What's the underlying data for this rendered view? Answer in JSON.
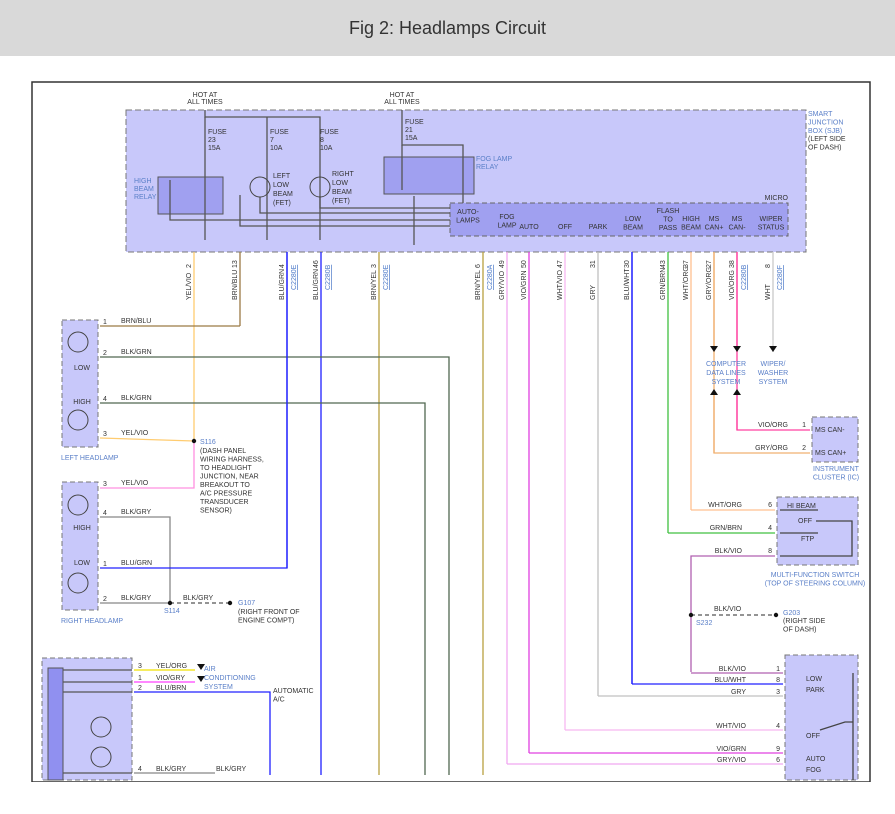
{
  "title": "Fig 2: Headlamps Circuit",
  "sjb": {
    "hot1": [
      "HOT AT",
      "ALL TIMES"
    ],
    "hot2": [
      "HOT AT",
      "ALL TIMES"
    ],
    "fuse23": [
      "FUSE",
      "23",
      "15A"
    ],
    "fuse7": [
      "FUSE",
      "7",
      "10A"
    ],
    "fuse8": [
      "FUSE",
      "8",
      "10A"
    ],
    "fuse21": [
      "FUSE",
      "21",
      "15A"
    ],
    "high_beam_relay": [
      "HIGH",
      "BEAM",
      "RELAY"
    ],
    "left_low_beam": [
      "LEFT",
      "LOW",
      "BEAM",
      "(FET)"
    ],
    "right_low_beam": [
      "RIGHT",
      "LOW",
      "BEAM",
      "(FET)"
    ],
    "fog_lamp_relay": [
      "FOG LAMP",
      "RELAY"
    ],
    "name": [
      "SMART",
      "JUNCTION",
      "BOX (SJB)"
    ],
    "location": [
      "(LEFT SIDE",
      "OF DASH)"
    ],
    "micro": "MICRO",
    "micro_pins": [
      [
        "AUTO-",
        "LAMPS"
      ],
      [
        "FOG",
        "LAMP"
      ],
      [
        "AUTO"
      ],
      [
        "OFF"
      ],
      [
        "PARK"
      ],
      [
        "LOW",
        "BEAM"
      ],
      [
        "FLASH",
        "TO",
        "PASS"
      ],
      [
        "HIGH",
        "BEAM"
      ],
      [
        "MS",
        "CAN+"
      ],
      [
        "MS",
        "CAN-"
      ],
      [
        "WIPER",
        "STATUS"
      ]
    ]
  },
  "wires": [
    {
      "label": "YEL/VIO",
      "pin": "2",
      "conn": "",
      "color": "#ffcc70"
    },
    {
      "label": "BRN/BLU",
      "pin": "13",
      "conn": "",
      "color": "#9b7a45"
    },
    {
      "label": "BLU/GRN",
      "pin": "4",
      "conn": "C2280E",
      "color": "#2020ff"
    },
    {
      "label": "BLU/GRN",
      "pin": "46",
      "conn": "C2280B",
      "color": "#2020ff"
    },
    {
      "label": "BRN/YEL",
      "pin": "3",
      "conn": "C2280E",
      "color": "#b8a040"
    },
    {
      "label": "BRN/YEL",
      "pin": "6",
      "conn": "C2280A",
      "color": "#b8a040"
    },
    {
      "label": "GRY/VIO",
      "pin": "49",
      "conn": "",
      "color": "#f0a8f0"
    },
    {
      "label": "VIO/GRN",
      "pin": "50",
      "conn": "",
      "color": "#e040e0"
    },
    {
      "label": "WHT/VIO",
      "pin": "47",
      "conn": "",
      "color": "#f8b8f0"
    },
    {
      "label": "GRY",
      "pin": "31",
      "conn": "",
      "color": "#c0c0c0"
    },
    {
      "label": "BLU/WHT",
      "pin": "30",
      "conn": "",
      "color": "#2020ff"
    },
    {
      "label": "GRN/BRN",
      "pin": "43",
      "conn": "",
      "color": "#40c040"
    },
    {
      "label": "WHT/ORG",
      "pin": "37",
      "conn": "",
      "color": "#ffc090"
    },
    {
      "label": "GRY/ORG",
      "pin": "27",
      "conn": "",
      "color": "#f0b070"
    },
    {
      "label": "VIO/ORG",
      "pin": "38",
      "conn": "C2280B",
      "color": "#ff40a0"
    },
    {
      "label": "WHT",
      "pin": "8",
      "conn": "C2280F",
      "color": "#d0d0d0"
    }
  ],
  "left_headlamp": {
    "name": "LEFT HEADLAMP",
    "low": "LOW",
    "high": "HIGH",
    "pins": [
      {
        "pin": "1",
        "wire": "BRN/BLU"
      },
      {
        "pin": "2",
        "wire": "BLK/GRN"
      },
      {
        "pin": "4",
        "wire": "BLK/GRN"
      },
      {
        "pin": "3",
        "wire": "YEL/VIO"
      }
    ]
  },
  "right_headlamp": {
    "name": "RIGHT HEADLAMP",
    "low": "LOW",
    "high": "HIGH",
    "pins": [
      {
        "pin": "3",
        "wire": "YEL/VIO"
      },
      {
        "pin": "4",
        "wire": "BLK/GRY"
      },
      {
        "pin": "1",
        "wire": "BLU/GRN"
      },
      {
        "pin": "2",
        "wire": "BLK/GRY"
      }
    ]
  },
  "s116": {
    "id": "S116",
    "desc": [
      "(DASH PANEL",
      "WIRING HARNESS,",
      "TO HEADLIGHT",
      "JUNCTION, NEAR",
      "BREAKOUT TO",
      "A/C PRESSURE",
      "TRANSDUCER",
      "SENSOR)"
    ]
  },
  "s114": "S114",
  "g107": {
    "id": "G107",
    "wire": "BLK/GRY",
    "desc": [
      "(RIGHT FRONT OF",
      "ENGINE COMPT)"
    ]
  },
  "computer_data": [
    "COMPUTER",
    "DATA LINES",
    "SYSTEM"
  ],
  "wiper": [
    "WIPER/",
    "WASHER",
    "SYSTEM"
  ],
  "ic": {
    "name": [
      "INSTRUMENT",
      "CLUSTER (IC)"
    ],
    "pins": [
      {
        "pin": "1",
        "wire": "VIO/ORG",
        "label": "MS CAN-"
      },
      {
        "pin": "2",
        "wire": "GRY/ORG",
        "label": "MS CAN+"
      }
    ]
  },
  "mfs": {
    "name": [
      "MULTI-FUNCTION SWITCH",
      "(TOP OF STEERING COLUMN)"
    ],
    "pins": [
      {
        "pin": "6",
        "wire": "WHT/ORG",
        "label": "HI BEAM"
      },
      {
        "pin": "4",
        "wire": "GRN/BRN",
        "label": "FTP"
      },
      {
        "pin": "8",
        "wire": "BLK/VIO",
        "label": ""
      }
    ],
    "off": "OFF"
  },
  "s232": "S232",
  "g203": {
    "id": "G203",
    "wire": "BLK/VIO",
    "desc": [
      "(RIGHT SIDE",
      "OF DASH)"
    ]
  },
  "headlamp_switch": {
    "pins": [
      {
        "pin": "1",
        "wire": "BLK/VIO",
        "label": "LOW"
      },
      {
        "pin": "8",
        "wire": "BLU/WHT",
        "label": "PARK"
      },
      {
        "pin": "3",
        "wire": "GRY",
        "label": ""
      },
      {
        "pin": "4",
        "wire": "WHT/VIO",
        "label": "OFF"
      },
      {
        "pin": "9",
        "wire": "VIO/GRN",
        "label": "AUTO"
      },
      {
        "pin": "6",
        "wire": "GRY/VIO",
        "label": "FOG"
      }
    ]
  },
  "ac_module": {
    "pins": [
      {
        "pin": "3",
        "wire": "YEL/ORG",
        "color": "#f0e000"
      },
      {
        "pin": "1",
        "wire": "VIO/GRY",
        "color": "#ff40ff"
      },
      {
        "pin": "2",
        "wire": "BLU/BRN",
        "color": "#2020ff"
      },
      {
        "pin": "4",
        "wire": "BLK/GRY",
        "color": "#909090"
      }
    ],
    "ac_system": [
      "AIR",
      "CONDITIONING",
      "SYSTEM"
    ],
    "auto_ac": [
      "AUTOMATIC",
      "A/C"
    ],
    "blk_gry": "BLK/GRY"
  }
}
